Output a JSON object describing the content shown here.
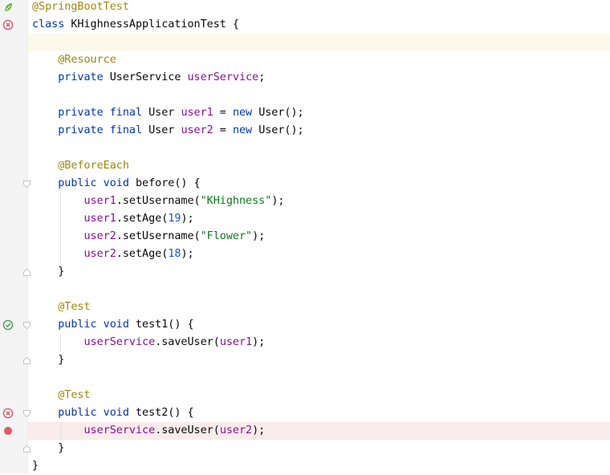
{
  "editor": {
    "lines": [
      [
        {
          "t": "@SpringBootTest",
          "c": "ann"
        }
      ],
      [
        {
          "t": "class ",
          "c": "kw"
        },
        {
          "t": "KHighnessApplicationTest {",
          "c": "plain"
        }
      ],
      [],
      [
        {
          "t": "    "
        },
        {
          "t": "@Resource",
          "c": "ann"
        }
      ],
      [
        {
          "t": "    "
        },
        {
          "t": "private ",
          "c": "kw"
        },
        {
          "t": "UserService ",
          "c": "plain"
        },
        {
          "t": "userService",
          "c": "field"
        },
        {
          "t": ";",
          "c": "plain"
        }
      ],
      [],
      [
        {
          "t": "    "
        },
        {
          "t": "private final ",
          "c": "kw"
        },
        {
          "t": "User ",
          "c": "plain"
        },
        {
          "t": "user1",
          "c": "field"
        },
        {
          "t": " = ",
          "c": "plain"
        },
        {
          "t": "new ",
          "c": "kw"
        },
        {
          "t": "User();",
          "c": "plain"
        }
      ],
      [
        {
          "t": "    "
        },
        {
          "t": "private final ",
          "c": "kw"
        },
        {
          "t": "User ",
          "c": "plain"
        },
        {
          "t": "user2",
          "c": "field"
        },
        {
          "t": " = ",
          "c": "plain"
        },
        {
          "t": "new ",
          "c": "kw"
        },
        {
          "t": "User();",
          "c": "plain"
        }
      ],
      [],
      [
        {
          "t": "    "
        },
        {
          "t": "@BeforeEach",
          "c": "ann"
        }
      ],
      [
        {
          "t": "    "
        },
        {
          "t": "public void ",
          "c": "kw"
        },
        {
          "t": "before() {",
          "c": "plain"
        }
      ],
      [
        {
          "t": "        "
        },
        {
          "t": "user1",
          "c": "field"
        },
        {
          "t": ".setUsername(",
          "c": "plain"
        },
        {
          "t": "\"KHighness\"",
          "c": "str"
        },
        {
          "t": ");",
          "c": "plain"
        }
      ],
      [
        {
          "t": "        "
        },
        {
          "t": "user1",
          "c": "field"
        },
        {
          "t": ".setAge(",
          "c": "plain"
        },
        {
          "t": "19",
          "c": "num"
        },
        {
          "t": ");",
          "c": "plain"
        }
      ],
      [
        {
          "t": "        "
        },
        {
          "t": "user2",
          "c": "field"
        },
        {
          "t": ".setUsername(",
          "c": "plain"
        },
        {
          "t": "\"Flower\"",
          "c": "str"
        },
        {
          "t": ");",
          "c": "plain"
        }
      ],
      [
        {
          "t": "        "
        },
        {
          "t": "user2",
          "c": "field"
        },
        {
          "t": ".setAge(",
          "c": "plain"
        },
        {
          "t": "18",
          "c": "num"
        },
        {
          "t": ");",
          "c": "plain"
        }
      ],
      [
        {
          "t": "    "
        },
        {
          "t": "}",
          "c": "plain"
        }
      ],
      [],
      [
        {
          "t": "    "
        },
        {
          "t": "@Test",
          "c": "ann"
        }
      ],
      [
        {
          "t": "    "
        },
        {
          "t": "public void ",
          "c": "kw"
        },
        {
          "t": "test1() {",
          "c": "plain"
        }
      ],
      [
        {
          "t": "        "
        },
        {
          "t": "userService",
          "c": "field"
        },
        {
          "t": ".saveUser(",
          "c": "plain"
        },
        {
          "t": "user1",
          "c": "field"
        },
        {
          "t": ");",
          "c": "plain"
        }
      ],
      [
        {
          "t": "    "
        },
        {
          "t": "}",
          "c": "plain"
        }
      ],
      [],
      [
        {
          "t": "    "
        },
        {
          "t": "@Test",
          "c": "ann"
        }
      ],
      [
        {
          "t": "    "
        },
        {
          "t": "public void ",
          "c": "kw"
        },
        {
          "t": "test2() {",
          "c": "plain"
        }
      ],
      [
        {
          "t": "        "
        },
        {
          "t": "userService",
          "c": "field"
        },
        {
          "t": ".saveUser(",
          "c": "plain"
        },
        {
          "t": "user2",
          "c": "field"
        },
        {
          "t": ");",
          "c": "plain"
        }
      ],
      [
        {
          "t": "    "
        },
        {
          "t": "}",
          "c": "plain"
        }
      ],
      [
        {
          "t": "}",
          "c": "plain"
        }
      ]
    ],
    "caret_line": 3,
    "breakpoint_line": 25
  },
  "gutter": {
    "markers": [
      {
        "line": 1,
        "icon": "spring-bean-icon"
      },
      {
        "line": 2,
        "icon": "test-failed-icon"
      },
      {
        "line": 19,
        "icon": "test-passed-icon"
      },
      {
        "line": 24,
        "icon": "test-failed-icon"
      },
      {
        "line": 25,
        "icon": "breakpoint-icon"
      }
    ],
    "fold_open_lines": [
      11,
      19,
      24
    ],
    "fold_close_lines": [
      16,
      21,
      26
    ]
  },
  "colors": {
    "annotation": "#9e880d",
    "keyword": "#0033b3",
    "field": "#871094",
    "string": "#067d17",
    "number": "#1750eb",
    "caret_line": "#fcf9eb",
    "breakpoint_line": "#fbebeb"
  }
}
